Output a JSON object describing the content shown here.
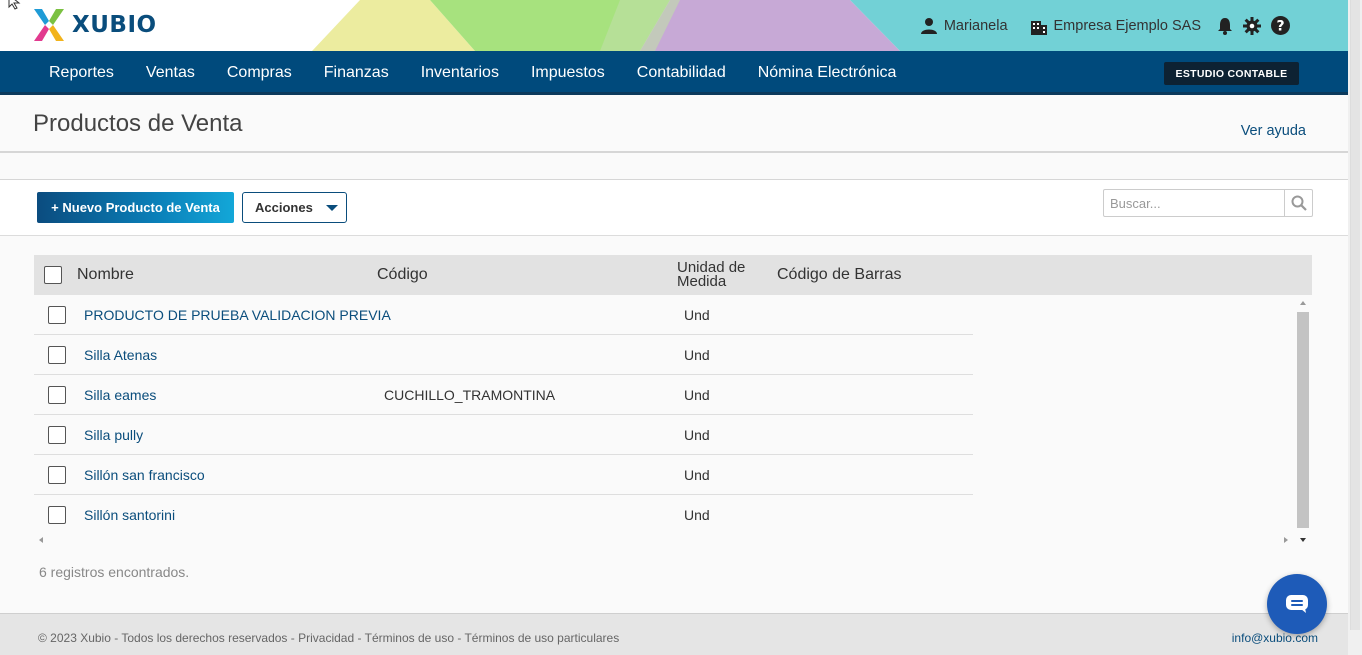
{
  "header": {
    "brand": "XUBIO",
    "user_name": "Marianela",
    "company_name": "Empresa Ejemplo SAS"
  },
  "nav": {
    "items": [
      {
        "label": "Reportes"
      },
      {
        "label": "Ventas"
      },
      {
        "label": "Compras"
      },
      {
        "label": "Finanzas"
      },
      {
        "label": "Inventarios"
      },
      {
        "label": "Impuestos"
      },
      {
        "label": "Contabilidad"
      },
      {
        "label": "Nómina Electrónica"
      }
    ],
    "studio_label": "ESTUDIO CONTABLE"
  },
  "page": {
    "title": "Productos de Venta",
    "help_link": "Ver ayuda"
  },
  "toolbar": {
    "new_button": "+ Nuevo Producto de Venta",
    "actions_button": "Acciones",
    "search_placeholder": "Buscar..."
  },
  "table": {
    "columns": {
      "name": "Nombre",
      "code": "Código",
      "unit_line1": "Unidad de",
      "unit_line2": "Medida",
      "barcode": "Código de Barras"
    },
    "rows": [
      {
        "name": "PRODUCTO DE PRUEBA VALIDACION PREVIA",
        "code": "",
        "unit": "Und",
        "barcode": ""
      },
      {
        "name": "Silla Atenas",
        "code": "",
        "unit": "Und",
        "barcode": ""
      },
      {
        "name": "Silla eames",
        "code": "CUCHILLO_TRAMONTINA",
        "unit": "Und",
        "barcode": ""
      },
      {
        "name": "Silla pully",
        "code": "",
        "unit": "Und",
        "barcode": ""
      },
      {
        "name": "Sillón san francisco",
        "code": "",
        "unit": "Und",
        "barcode": ""
      },
      {
        "name": "Sillón santorini",
        "code": "",
        "unit": "Und",
        "barcode": ""
      }
    ],
    "records_found": "6 registros encontrados."
  },
  "footer": {
    "copyright": "© 2023 Xubio - Todos los derechos reservados",
    "privacy": "Privacidad",
    "terms": "Términos de uso",
    "terms_particular": "Términos de uso particulares",
    "email": "info@xubio.com"
  },
  "colors": {
    "primary": "#004a7c",
    "link": "#0a4d7c",
    "chat": "#1e5bb8"
  }
}
